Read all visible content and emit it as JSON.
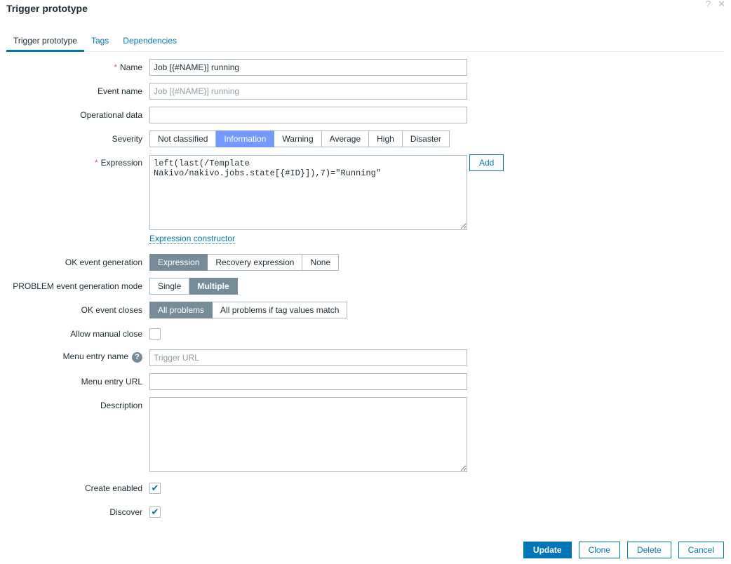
{
  "title": "Trigger prototype",
  "tabs": [
    "Trigger prototype",
    "Tags",
    "Dependencies"
  ],
  "labels": {
    "name": "Name",
    "event_name": "Event name",
    "opdata": "Operational data",
    "severity": "Severity",
    "expression": "Expression",
    "ok_gen": "OK event generation",
    "problem_mode": "PROBLEM event generation mode",
    "ok_closes": "OK event closes",
    "manual_close": "Allow manual close",
    "menu_name": "Menu entry name",
    "menu_url": "Menu entry URL",
    "description": "Description",
    "create_enabled": "Create enabled",
    "discover": "Discover"
  },
  "values": {
    "name": "Job [{#NAME}] running",
    "event_name_placeholder": "Job [{#NAME}] running",
    "opdata": "",
    "expression": "left(last(/Template Nakivo/nakivo.jobs.state[{#ID}]),7)=\"Running\"",
    "menu_name_placeholder": "Trigger URL",
    "menu_url": "",
    "description": ""
  },
  "severity": {
    "options": [
      "Not classified",
      "Information",
      "Warning",
      "Average",
      "High",
      "Disaster"
    ],
    "selected": "Information"
  },
  "ok_gen": {
    "options": [
      "Expression",
      "Recovery expression",
      "None"
    ],
    "selected": "Expression"
  },
  "problem_mode": {
    "options": [
      "Single",
      "Multiple"
    ],
    "selected": "Multiple"
  },
  "ok_closes": {
    "options": [
      "All problems",
      "All problems if tag values match"
    ],
    "selected": "All problems"
  },
  "checks": {
    "manual_close": false,
    "create_enabled": true,
    "discover": true
  },
  "add_label": "Add",
  "expr_constructor": "Expression constructor",
  "help": "?",
  "header_icons": {
    "help": "?",
    "close": "✕"
  },
  "buttons": {
    "update": "Update",
    "clone": "Clone",
    "delete": "Delete",
    "cancel": "Cancel"
  }
}
